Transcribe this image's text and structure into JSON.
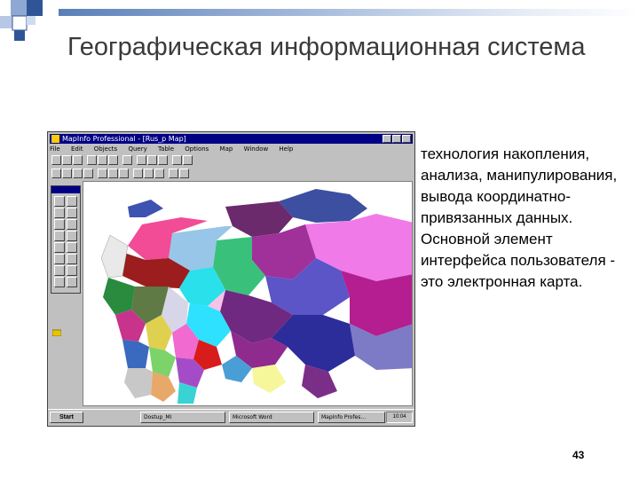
{
  "slide": {
    "title": "Географическая информационная система",
    "description": "технология накопления, анализа, манипулирования, вывода координатно-привязанных данных. Основной элемент интерфейса пользователя - это электронная карта.",
    "page_number": "43"
  },
  "screenshot": {
    "titlebar_text": "MapInfo Professional - [Rus_p Map]",
    "menu": [
      "File",
      "Edit",
      "Objects",
      "Query",
      "Table",
      "Options",
      "Map",
      "Window",
      "Help"
    ],
    "taskbar": {
      "start_label": "Start",
      "tasks": [
        "Dostup_MI",
        "Microsoft Word",
        "MapInfo Profes..."
      ],
      "clock": "10:04"
    },
    "colors": {
      "titlebar": "#000084",
      "window": "#c0c0c0",
      "accent_rule": "#5a7fb8"
    }
  }
}
